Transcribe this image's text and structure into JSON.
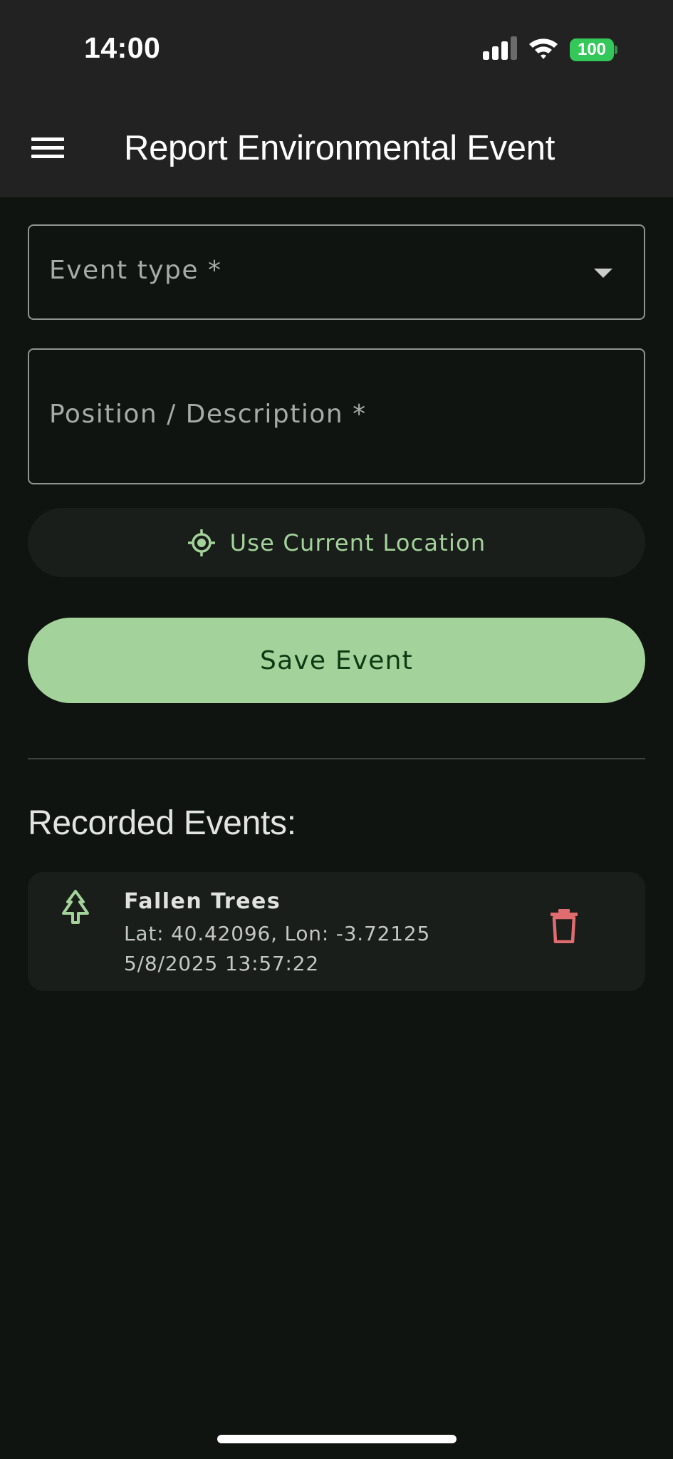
{
  "status_bar": {
    "time": "14:00",
    "battery_level": "100",
    "icons": [
      "cellular-signal-icon",
      "wifi-icon",
      "battery-icon"
    ]
  },
  "app_bar": {
    "menu_icon": "menu-icon",
    "title": "Report Environmental Event"
  },
  "form": {
    "event_type": {
      "label": "Event type *",
      "value": "",
      "icon": "dropdown-arrow-icon"
    },
    "position": {
      "label": "Position / Description *",
      "value": ""
    },
    "use_location_button": {
      "label": "Use Current Location",
      "icon": "my-location-icon"
    },
    "save_button": {
      "label": "Save Event"
    }
  },
  "recorded": {
    "title": "Recorded Events:",
    "events": [
      {
        "title": "Fallen Trees",
        "coords": "Lat: 40.42096, Lon: -3.72125",
        "timestamp": "5/8/2025 13:57:22",
        "icon": "tree-icon",
        "delete_icon": "trash-icon"
      }
    ]
  },
  "colors": {
    "background": "#0f1410",
    "app_bar": "#222222",
    "accent_green": "#a3d39a",
    "save_text": "#0d3a12",
    "card": "#1a1e1a",
    "delete_red": "#e06c6f",
    "battery_green": "#34c759"
  }
}
